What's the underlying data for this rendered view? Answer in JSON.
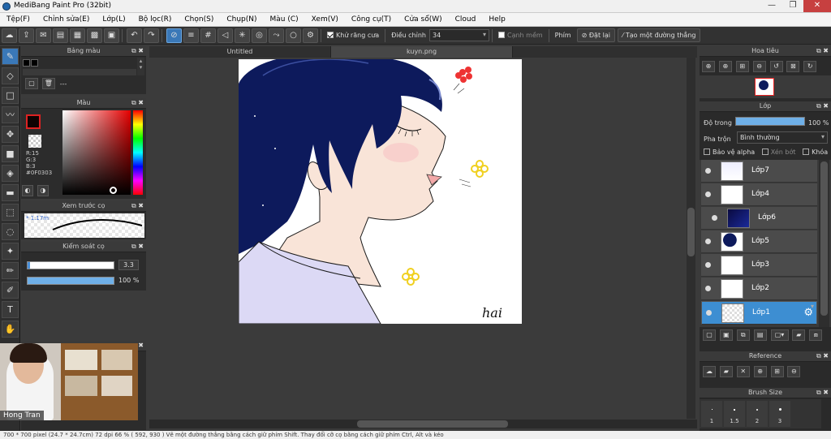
{
  "window": {
    "title": "MediBang Paint Pro (32bit)"
  },
  "menu": [
    "Tệp(F)",
    "Chỉnh sửa(E)",
    "Lớp(L)",
    "Bộ lọc(R)",
    "Chọn(S)",
    "Chụp(N)",
    "Màu (C)",
    "Xem(V)",
    "Công cụ(T)",
    "Cửa sổ(W)",
    "Cloud",
    "Help"
  ],
  "toolbar": {
    "antialias_label": "Khử răng cưa",
    "adjust_label": "Điều chỉnh",
    "adjust_value": "34",
    "edge_label": "Cạnh mềm",
    "key_label": "Phím",
    "reset_label": "Đặt lại",
    "create_line_label": "Tạo một đường thẳng"
  },
  "palette_panel": {
    "title": "Bảng màu",
    "label": "---"
  },
  "color_panel": {
    "title": "Màu",
    "r": "R:15",
    "g": "G:3",
    "b": "B:3",
    "hex": "#0F0303"
  },
  "brush_preview": {
    "title": "Xem trước cọ",
    "size": "* 1.17m"
  },
  "brush_control": {
    "title": "Kiểm soát cọ",
    "size_value": "3.3",
    "opacity_value": "100 %"
  },
  "tabs": [
    "Untitled",
    "kuyn.png"
  ],
  "navigator": {
    "title": "Hoa tiêu"
  },
  "layer_panel": {
    "title": "Lớp",
    "opacity_label": "Độ trong",
    "opacity_value": "100 %",
    "opacity": 1.0,
    "blend_label": "Pha trộn",
    "blend_value": "Bình thường",
    "protect_alpha": "Bảo vệ alpha",
    "clipping": "Xén bớt",
    "lock": "Khóa",
    "layers": [
      {
        "name": "Lớp7"
      },
      {
        "name": "Lớp4"
      },
      {
        "name": "Lớp6"
      },
      {
        "name": "Lớp5"
      },
      {
        "name": "Lớp3"
      },
      {
        "name": "Lớp2"
      },
      {
        "name": "Lớp1"
      }
    ]
  },
  "reference_panel": {
    "title": "Reference"
  },
  "brush_size_panel": {
    "title": "Brush Size",
    "sizes": [
      "1",
      "1.5",
      "2",
      "3"
    ]
  },
  "webcam": {
    "name": "Hong Tran"
  },
  "canvas": {
    "signature": "hai"
  },
  "statusbar": {
    "text": "700 * 700 pixel  (24.7 * 24.7cm)  72 dpi  66 %  ( 592, 930 )  Vẽ một đường thẳng bằng cách giữ phím Shift. Thay đổi cỡ cọ bằng cách giữ phím Ctrl, Alt và kéo"
  }
}
